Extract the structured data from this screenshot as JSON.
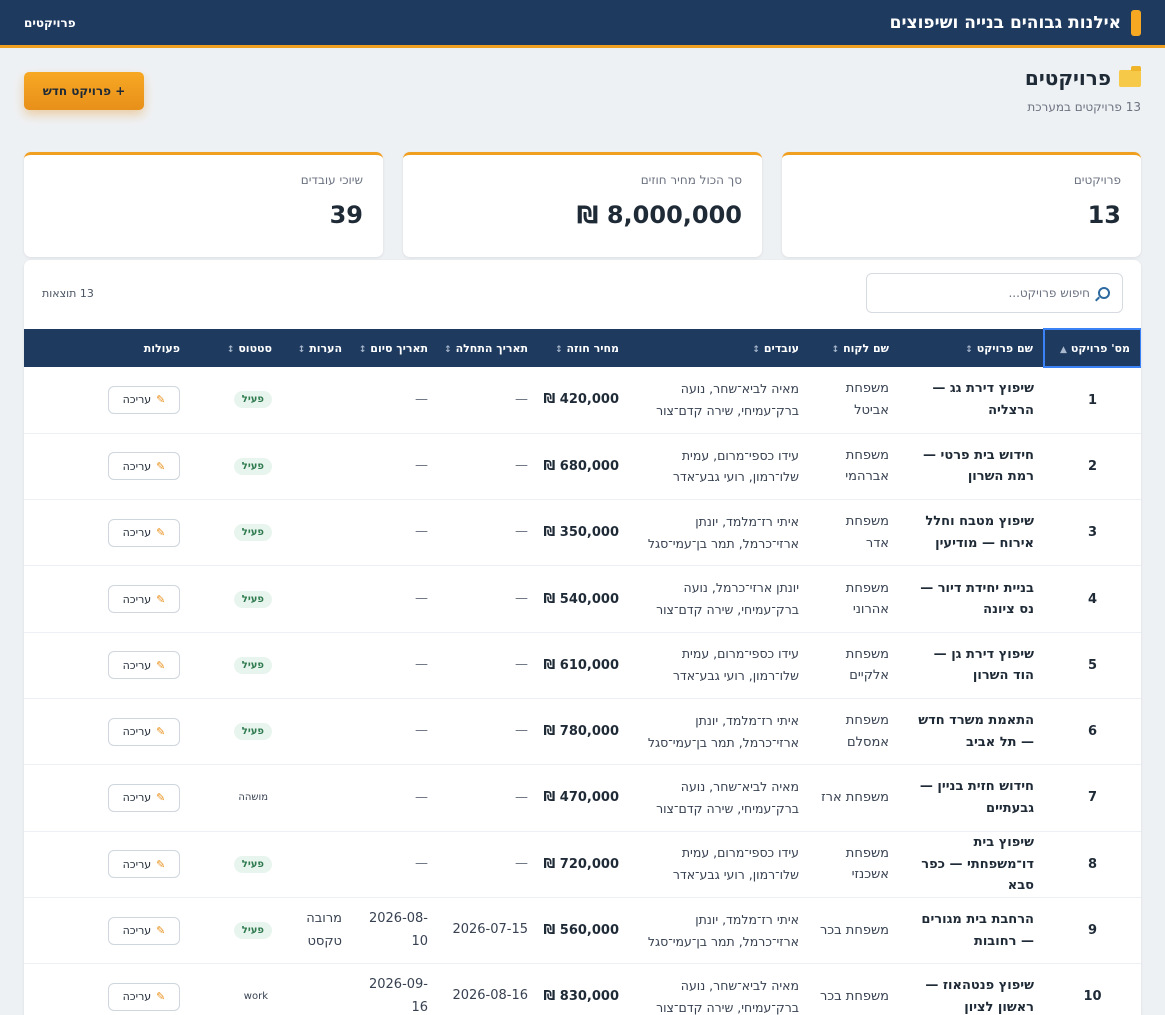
{
  "header": {
    "brand_title": "אילנות גבוהים בנייה ושיפוצים",
    "nav_label": "פרויקטים"
  },
  "page": {
    "title": "פרויקטים",
    "subtitle": "13 פרויקטים במערכת",
    "new_button_label": "+ פרויקט חדש"
  },
  "stats": [
    {
      "label": "פרויקטים",
      "value": "13"
    },
    {
      "label": "סך הכול מחיר חוזים",
      "value": "8,000,000 ₪"
    },
    {
      "label": "שיוכי עובדים",
      "value": "39"
    }
  ],
  "search": {
    "placeholder": "חיפוש פרויקט...",
    "results_label": "13 תוצאות"
  },
  "table": {
    "columns": [
      "מס' פרויקט",
      "שם פרויקט",
      "שם לקוח",
      "עובדים",
      "מחיר חוזה",
      "תאריך התחלה",
      "תאריך סיום",
      "הערות",
      "סטטוס",
      "פעולות"
    ],
    "sort_glyph": "↕",
    "sort_active_glyph": "▲",
    "edit_label": "עריכה",
    "rows": [
      {
        "num": "1",
        "name": "שיפוץ דירת גג — הרצליה",
        "client": "משפחת אביטל",
        "workers": "מאיה לביא־שחר, נועה ברק־עמיחי, שירה קדם־צור",
        "price": "420,000 ₪",
        "start": "—",
        "end": "—",
        "notes": "",
        "status": "פעיל",
        "status_style": "badge"
      },
      {
        "num": "2",
        "name": "חידוש בית פרטי — רמת השרון",
        "client": "משפחת אברהמי",
        "workers": "עידו כספי־מרום, עמית שלו־רמון, רועי גבע־אדר",
        "price": "680,000 ₪",
        "start": "—",
        "end": "—",
        "notes": "",
        "status": "פעיל",
        "status_style": "badge"
      },
      {
        "num": "3",
        "name": "שיפוץ מטבח וחלל אירוח — מודיעין",
        "client": "משפחת אדר",
        "workers": "איתי רז־מלמד, יונתן ארזי־כרמל, תמר בן־עמי־סגל",
        "price": "350,000 ₪",
        "start": "—",
        "end": "—",
        "notes": "",
        "status": "פעיל",
        "status_style": "badge"
      },
      {
        "num": "4",
        "name": "בניית יחידת דיור — נס ציונה",
        "client": "משפחת אהרוני",
        "workers": "יונתן ארזי־כרמל, נועה ברק־עמיחי, שירה קדם־צור",
        "price": "540,000 ₪",
        "start": "—",
        "end": "—",
        "notes": "",
        "status": "פעיל",
        "status_style": "badge"
      },
      {
        "num": "5",
        "name": "שיפוץ דירת גן — הוד השרון",
        "client": "משפחת אלקיים",
        "workers": "עידו כספי־מרום, עמית שלו־רמון, רועי גבע־אדר",
        "price": "610,000 ₪",
        "start": "—",
        "end": "—",
        "notes": "",
        "status": "פעיל",
        "status_style": "badge"
      },
      {
        "num": "6",
        "name": "התאמת משרד חדש — תל אביב",
        "client": "משפחת אמסלם",
        "workers": "איתי רז־מלמד, יונתן ארזי־כרמל, תמר בן־עמי־סגל",
        "price": "780,000 ₪",
        "start": "—",
        "end": "—",
        "notes": "",
        "status": "פעיל",
        "status_style": "badge"
      },
      {
        "num": "7",
        "name": "חידוש חזית בניין — גבעתיים",
        "client": "משפחת ארז",
        "workers": "מאיה לביא־שחר, נועה ברק־עמיחי, שירה קדם־צור",
        "price": "470,000 ₪",
        "start": "—",
        "end": "—",
        "notes": "",
        "status": "מושהה",
        "status_style": "plain"
      },
      {
        "num": "8",
        "name": "שיפוץ בית דו־משפחתי — כפר סבא",
        "client": "משפחת אשכנזי",
        "workers": "עידו כספי־מרום, עמית שלו־רמון, רועי גבע־אדר",
        "price": "720,000 ₪",
        "start": "—",
        "end": "—",
        "notes": "",
        "status": "פעיל",
        "status_style": "badge"
      },
      {
        "num": "9",
        "name": "הרחבת בית מגורים — רחובות",
        "client": "משפחת בכר",
        "workers": "איתי רז־מלמד, יונתן ארזי־כרמל, תמר בן־עמי־סגל",
        "price": "560,000 ₪",
        "start": "2026-07-15",
        "end": "2026-08-10",
        "notes": "מרובה טקסט",
        "status": "פעיל",
        "status_style": "badge"
      },
      {
        "num": "10",
        "name": "שיפוץ פנטהאוז — ראשון לציון",
        "client": "משפחת בכר",
        "workers": "מאיה לביא־שחר, נועה ברק־עמיחי, שירה קדם־צור",
        "price": "830,000 ₪",
        "start": "2026-08-16",
        "end": "2026-09-16",
        "notes": "",
        "status": "work",
        "status_style": "plain"
      }
    ]
  },
  "colors": {
    "navy": "#1e3a5f",
    "accent": "#f0a020",
    "status_active_bg": "#e8f5ee",
    "status_active_text": "#2f7a4f"
  },
  "icons": [
    "folder-icon",
    "search-icon",
    "pencil-icon",
    "sort-icon",
    "brand-mark-icon"
  ]
}
